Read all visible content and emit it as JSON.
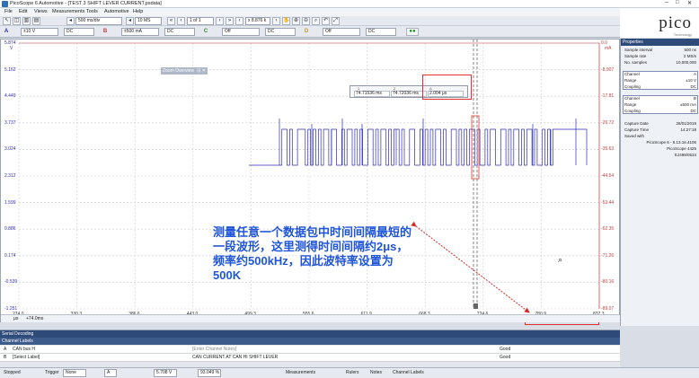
{
  "window": {
    "title": "PicoScope 6 Automotive - [TEST 3 SHIFT LEVER CURRENT.psdata]"
  },
  "menu": [
    "File",
    "Edit",
    "Views",
    "Measurements",
    "Tools",
    "Automotive",
    "Help"
  ],
  "toolbar": {
    "timebase": "500 ms/div",
    "samples": "10 MS",
    "page": "1 of 1",
    "zoom": "x 8.876 k"
  },
  "channels": {
    "a": {
      "letter": "A",
      "range": "±10 V",
      "coupling": "DC",
      "color": "#2b2bb8"
    },
    "b": {
      "letter": "B",
      "range": "±500 mA",
      "coupling": "DC",
      "color": "#c33b3b"
    },
    "c": {
      "letter": "C",
      "range": "Off",
      "coupling": "DC"
    },
    "d": {
      "letter": "D",
      "range": "Off",
      "coupling": "DC"
    }
  },
  "logo": {
    "brand": "pico",
    "sub": "Technology"
  },
  "plot": {
    "left_unit": "V",
    "right_unit": "mA",
    "left_ticks": [
      "5.874",
      "5.162",
      "4.449",
      "3.737",
      "3.024",
      "2.312",
      "1.599",
      "0.886",
      "0.174",
      "-0.539",
      "-1.251"
    ],
    "right_ticks": [
      "0.0",
      "-8.907",
      "-17.81",
      "-26.72",
      "-35.63",
      "-44.54",
      "-53.44",
      "-62.35",
      "-71.26",
      "-80.16",
      "-89.07"
    ],
    "x_ticks": [
      "274.0",
      "330.3",
      "386.6",
      "443.0",
      "499.3",
      "555.6",
      "611.9",
      "668.3",
      "724.6",
      "780.9",
      "837.3"
    ],
    "x_unit": "μs",
    "x_offset": "+74.0ms",
    "zoom_overview": "Zoom Overview"
  },
  "rulers": {
    "ruler1": "74.71536 ms",
    "ruler2": "74.72036 ms",
    "delta": "2.004 μs",
    "freq": "499 kHz"
  },
  "annotation": "测量任意一个数据包中时间间隔最短的一段波形，这里测得时间间隔约2μs，频率约500kHz，因此波特率设置为500K",
  "properties": {
    "header": "Properties",
    "general": [
      {
        "k": "Sample interval",
        "v": "500 ns"
      },
      {
        "k": "Sample rate",
        "v": "2 MS/s"
      },
      {
        "k": "No. samples",
        "v": "10,000,000"
      }
    ],
    "chA": [
      {
        "k": "Channel",
        "v": "A"
      },
      {
        "k": "Range",
        "v": "±10 V"
      },
      {
        "k": "Coupling",
        "v": "DC"
      }
    ],
    "chB": [
      {
        "k": "Channel",
        "v": "B"
      },
      {
        "k": "Range",
        "v": "±500 mA"
      },
      {
        "k": "Coupling",
        "v": "DC"
      }
    ],
    "capture": [
      {
        "k": "Capture Date",
        "v": "28/01/2019"
      },
      {
        "k": "Capture Time",
        "v": "14:27:18"
      },
      {
        "k": "Saved with",
        "v": ""
      }
    ],
    "saved": [
      "PicoScope 6 - 6.13.16.4106",
      "PicoScope 4425",
      "EJ498/0534"
    ]
  },
  "serial": {
    "header": "Serial Decoding",
    "sub": "Channel Labels",
    "rows": [
      {
        "ch": "A",
        "label": "CAN bus H",
        "note": "[Enter Channel Notes]",
        "status": "Good"
      },
      {
        "ch": "B",
        "label": "[Select Label]",
        "note": "CAN CURRENT AT CAN HI SHIFT LEVER",
        "status": "Good"
      }
    ]
  },
  "status": {
    "state": "Stopped",
    "trigger_label": "Trigger",
    "trigger_mode": "None",
    "trigger_channel": "A",
    "level": "5.708 V",
    "pretrigger": "93.049 %",
    "measurements": "Measurements",
    "rulers": "Rulers",
    "notes": "Notes",
    "channel_labels": "Channel Labels"
  }
}
